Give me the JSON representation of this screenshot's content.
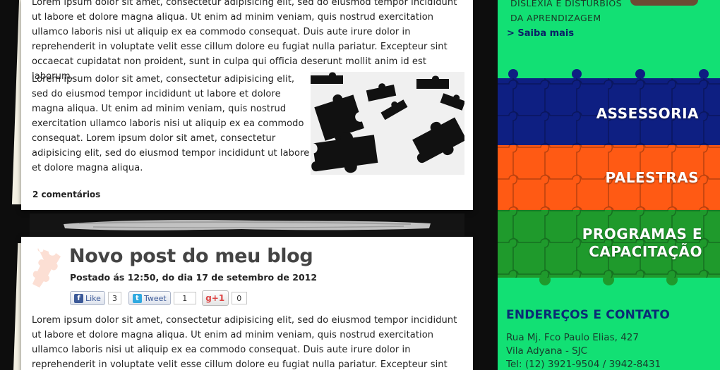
{
  "post1": {
    "paragraph_top": "Lorem ipsum dolor sit amet, consectetur adipisicing elit, sed do eiusmod tempor incididunt ut labore et dolore magna aliqua. Ut enim ad minim veniam, quis nostrud exercitation ullamco laboris nisi ut aliquip ex ea commodo consequat. Duis aute irure dolor in reprehenderit in voluptate velit esse cillum dolore eu fugiat nulla pariatur. Excepteur sint occaecat cupidatat non proident, sunt in culpa qui officia deserunt mollit anim id est laborum.",
    "paragraph_side": "Lorem ipsum dolor sit amet, consectetur adipisicing elit, sed do eiusmod tempor incididunt ut labore et dolore magna aliqua. Ut enim ad minim veniam, quis nostrud exercitation ullamco laboris nisi ut aliquip ex ea commodo consequat. Lorem ipsum dolor sit amet, consectetur adipisicing elit, sed do eiusmod tempor incididunt ut labore et dolore magna aliqua.",
    "comments": "2 comentários"
  },
  "post2": {
    "title": "Novo post do meu blog",
    "meta": "Postado ás 12:50, do dia 17 de setembro de 2012",
    "share": {
      "like_label": "Like",
      "like_count": "3",
      "tweet_label": "Tweet",
      "tweet_count": "1",
      "plus_label": "+1",
      "plus_count": "0"
    },
    "paragraph": "Lorem ipsum dolor sit amet, consectetur adipisicing elit, sed do eiusmod tempor incididunt ut labore et dolore magna aliqua. Ut enim ad minim veniam, quis nostrud exercitation ullamco laboris nisi ut aliquip ex ea commodo consequat. Duis aute irure dolor in reprehenderit in voluptate velit esse cillum dolore eu fugiat nulla pariatur. Excepteur sint occaecat cupidatat non"
  },
  "sidebar": {
    "top_line1": "DISLEXIA E  DISTÚRBIOS",
    "top_line2": "DA APRENDIZAGEM",
    "saiba_mais": "> Saiba mais",
    "menu": {
      "assessoria": "ASSESSORIA",
      "palestras": "PALESTRAS",
      "programas_line1": "PROGRAMAS E",
      "programas_line2": "CAPACITAÇÃO"
    },
    "contact": {
      "title": "ENDEREÇOS E CONTATO",
      "address": "Rua Mj. Fco Paulo Elias, 427",
      "district": "Vila Adyana - SJC",
      "phone": "Tel: (12) 3921-9504 / 3942-8431"
    }
  },
  "colors": {
    "sidebar_green": "#12e074",
    "band_blue": "#0e1f82",
    "band_orange": "#ff5a14",
    "band_green": "#1f9a2c",
    "heading_navy": "#0a2a75"
  },
  "icons": [
    "puzzle-piece-icon",
    "facebook-icon",
    "twitter-icon",
    "google-plus-icon"
  ]
}
